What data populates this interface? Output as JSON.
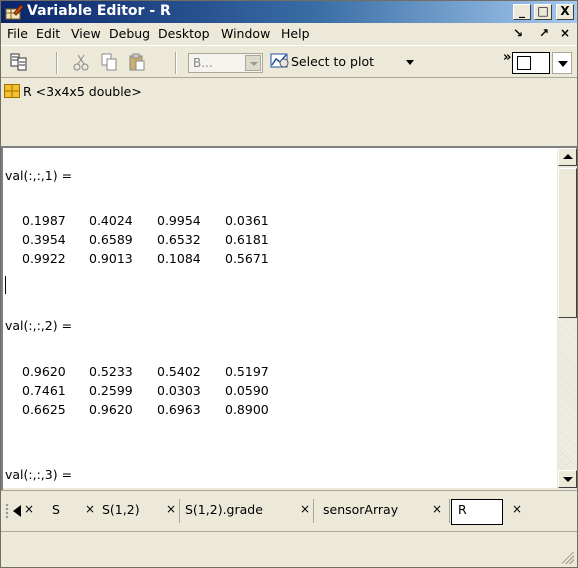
{
  "window": {
    "title": "Variable Editor - R"
  },
  "menu": {
    "items": [
      "File",
      "Edit",
      "View",
      "Debug",
      "Desktop",
      "Window",
      "Help"
    ]
  },
  "toolbar": {
    "combo_value": "B...",
    "plot_label": "Select to plot"
  },
  "variable": {
    "label": "R <3x4x5 double>"
  },
  "content": {
    "slices": [
      {
        "header": "val(:,:,1) =",
        "rows": [
          [
            "0.1987",
            "0.4024",
            "0.9954",
            "0.0361"
          ],
          [
            "0.3954",
            "0.6589",
            "0.6532",
            "0.6181"
          ],
          [
            "0.9922",
            "0.9013",
            "0.1084",
            "0.5671"
          ]
        ]
      },
      {
        "header": "val(:,:,2) =",
        "rows": [
          [
            "0.9620",
            "0.5233",
            "0.5402",
            "0.5197"
          ],
          [
            "0.7461",
            "0.2599",
            "0.0303",
            "0.0590"
          ],
          [
            "0.6625",
            "0.9620",
            "0.6963",
            "0.8900"
          ]
        ]
      },
      {
        "header": "val(:,:,3) =",
        "rows": []
      }
    ]
  },
  "tabs": [
    {
      "label": "S"
    },
    {
      "label": "S(1,2)"
    },
    {
      "label": "S(1,2).grade"
    },
    {
      "label": "sensorArray"
    },
    {
      "label": "R",
      "active": true
    }
  ],
  "colors": {
    "titlebar_start": "#0a246a",
    "titlebar_end": "#a6caf0",
    "chrome": "#ece9d8"
  }
}
